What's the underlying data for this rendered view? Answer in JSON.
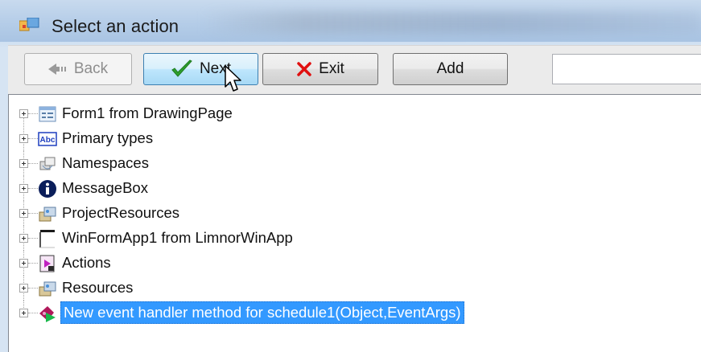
{
  "window": {
    "title": "Select an action"
  },
  "toolbar": {
    "back_label": "Back",
    "next_label": "Next",
    "exit_label": "Exit",
    "add_label": "Add",
    "search_value": ""
  },
  "tree": {
    "items": [
      {
        "label": "Form1 from DrawingPage",
        "icon": "form-icon"
      },
      {
        "label": "Primary types",
        "icon": "abc-type-icon"
      },
      {
        "label": "Namespaces",
        "icon": "namespace-icon"
      },
      {
        "label": "MessageBox",
        "icon": "info-icon"
      },
      {
        "label": "ProjectResources",
        "icon": "resources-icon"
      },
      {
        "label": "WinFormApp1 from LimnorWinApp",
        "icon": "app-window-icon"
      },
      {
        "label": "Actions",
        "icon": "actions-icon"
      },
      {
        "label": "Resources",
        "icon": "resources-icon"
      },
      {
        "label": "New event handler method for schedule1(Object,EventArgs)",
        "icon": "event-method-icon",
        "selected": true
      }
    ]
  },
  "colors": {
    "selection": "#3399ff",
    "next_check": "#2ea02e",
    "exit_x": "#e01010"
  }
}
